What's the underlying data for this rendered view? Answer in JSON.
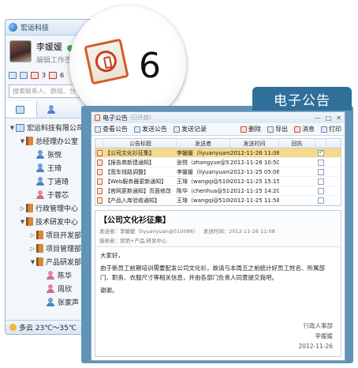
{
  "client": {
    "title": "宏运科技",
    "user_name": "李媛媛",
    "signature": "编辑工作签名",
    "mail_count": "3",
    "notice_count": "6",
    "search_placeholder": "搜索联系人、群组、分",
    "weather": "多云 23℃～35℃",
    "tree": [
      {
        "label": "宏运科技有限公司",
        "level": 0,
        "type": "company",
        "expanded": true
      },
      {
        "label": "总经理办公室",
        "level": 1,
        "type": "dept",
        "expanded": true
      },
      {
        "label": "张悦",
        "level": 2,
        "type": "user-m"
      },
      {
        "label": "王琦",
        "level": 2,
        "type": "user-m"
      },
      {
        "label": "丁道琦",
        "level": 2,
        "type": "user-m"
      },
      {
        "label": "于蓉芯",
        "level": 2,
        "type": "user-f"
      },
      {
        "label": "行政管理中心",
        "level": 1,
        "type": "dept",
        "expanded": false
      },
      {
        "label": "技术研发中心",
        "level": 1,
        "type": "dept",
        "expanded": true
      },
      {
        "label": "项目开发部",
        "level": 2,
        "type": "dept",
        "expanded": false
      },
      {
        "label": "项目管理部",
        "level": 2,
        "type": "dept",
        "expanded": false
      },
      {
        "label": "产品研发部",
        "level": 2,
        "type": "dept",
        "expanded": true
      },
      {
        "label": "陈华",
        "level": 3,
        "type": "user-f"
      },
      {
        "label": "周欣",
        "level": 3,
        "type": "user-f"
      },
      {
        "label": "张家声",
        "level": 3,
        "type": "user-m"
      }
    ]
  },
  "badge": {
    "count": "6"
  },
  "announcement": {
    "banner": "电子公告",
    "window_title": "电子公告",
    "window_subtitle": "(已开启)",
    "toolbar": {
      "view": "查看公告",
      "send": "发送公告",
      "record": "发送记录",
      "delete": "删除",
      "export": "导出",
      "message": "消息",
      "print": "打印"
    },
    "columns": [
      "公告标题",
      "发送者",
      "发送时间",
      "回执"
    ],
    "rows": [
      {
        "title": "【公司文化衫征集】",
        "sender": "李媛媛（liyuanyuan@...",
        "time": "2012-11-26 11:08",
        "receipt": "",
        "checked": true,
        "selected": true
      },
      {
        "title": "【报告商新建通知】",
        "sender": "张悦（zhangyue@51...",
        "time": "2012-11-26 10:50",
        "receipt": "",
        "checked": false,
        "selected": false
      },
      {
        "title": "【宽车线路调整】",
        "sender": "李媛媛（liyuanyuan@...",
        "time": "2012-11-25 05:06",
        "receipt": "",
        "checked": false,
        "selected": false
      },
      {
        "title": "【Web服务器更新通知】",
        "sender": "王琦（wangqi@5100...",
        "time": "2012-11-25 15:15",
        "receipt": "",
        "checked": false,
        "selected": false
      },
      {
        "title": "【官网更新通知】页面修改",
        "sender": "陈华（chenhua@510...",
        "time": "2012-11-25 14:20",
        "receipt": "",
        "checked": false,
        "selected": false
      },
      {
        "title": "【产品入库验收通知】",
        "sender": "王琦（wangqi@5100...",
        "time": "2012-11-25 11:58",
        "receipt": "",
        "checked": false,
        "selected": false
      }
    ],
    "detail": {
      "title": "【公司文化衫征集】",
      "meta_sender": "发送者：李媛媛（liyuanyuan@510086）",
      "meta_time": "发送时间：2012-11-26 11:08",
      "meta_receiver": "接收者：营销+产品,研发中心",
      "greeting": "大家好，",
      "body": "由于新员工前期培训需要配发公司文化衫，故请与本周五之前统计好员工姓名、所属部门、职务、衣服尺寸等相关信息，并由各部门负责人同意提交我吧。",
      "thanks": "谢谢。",
      "sign_dept": "行政人事部",
      "sign_name": "李媛媛",
      "sign_date": "2012-11-26"
    }
  }
}
